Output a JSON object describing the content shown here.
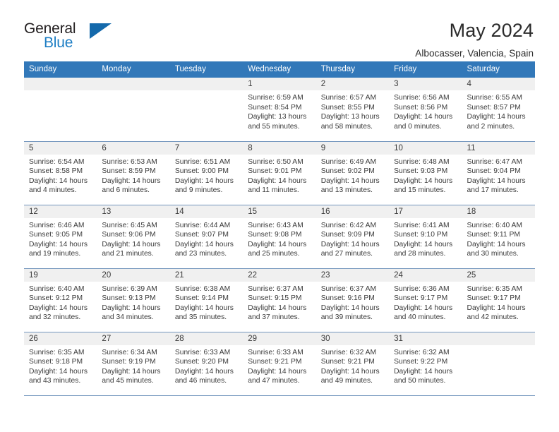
{
  "brand": {
    "name_part1": "General",
    "name_part2": "Blue",
    "logo_icon": "triangle-icon",
    "color_dark": "#231f20",
    "color_blue": "#1d7ec4",
    "color_triangle": "#1469ab"
  },
  "header": {
    "title": "May 2024",
    "subtitle": "Albocasser, Valencia, Spain"
  },
  "theme": {
    "header_row_bg": "#3278b9",
    "daynum_bg": "#f0f0f0",
    "row_border": "#7396bd"
  },
  "weekdays": [
    "Sunday",
    "Monday",
    "Tuesday",
    "Wednesday",
    "Thursday",
    "Friday",
    "Saturday"
  ],
  "weeks": [
    [
      {
        "day": "",
        "empty": true
      },
      {
        "day": "",
        "empty": true
      },
      {
        "day": "",
        "empty": true
      },
      {
        "day": "1",
        "sunrise": "Sunrise: 6:59 AM",
        "sunset": "Sunset: 8:54 PM",
        "daylight1": "Daylight: 13 hours",
        "daylight2": "and 55 minutes."
      },
      {
        "day": "2",
        "sunrise": "Sunrise: 6:57 AM",
        "sunset": "Sunset: 8:55 PM",
        "daylight1": "Daylight: 13 hours",
        "daylight2": "and 58 minutes."
      },
      {
        "day": "3",
        "sunrise": "Sunrise: 6:56 AM",
        "sunset": "Sunset: 8:56 PM",
        "daylight1": "Daylight: 14 hours",
        "daylight2": "and 0 minutes."
      },
      {
        "day": "4",
        "sunrise": "Sunrise: 6:55 AM",
        "sunset": "Sunset: 8:57 PM",
        "daylight1": "Daylight: 14 hours",
        "daylight2": "and 2 minutes."
      }
    ],
    [
      {
        "day": "5",
        "sunrise": "Sunrise: 6:54 AM",
        "sunset": "Sunset: 8:58 PM",
        "daylight1": "Daylight: 14 hours",
        "daylight2": "and 4 minutes."
      },
      {
        "day": "6",
        "sunrise": "Sunrise: 6:53 AM",
        "sunset": "Sunset: 8:59 PM",
        "daylight1": "Daylight: 14 hours",
        "daylight2": "and 6 minutes."
      },
      {
        "day": "7",
        "sunrise": "Sunrise: 6:51 AM",
        "sunset": "Sunset: 9:00 PM",
        "daylight1": "Daylight: 14 hours",
        "daylight2": "and 9 minutes."
      },
      {
        "day": "8",
        "sunrise": "Sunrise: 6:50 AM",
        "sunset": "Sunset: 9:01 PM",
        "daylight1": "Daylight: 14 hours",
        "daylight2": "and 11 minutes."
      },
      {
        "day": "9",
        "sunrise": "Sunrise: 6:49 AM",
        "sunset": "Sunset: 9:02 PM",
        "daylight1": "Daylight: 14 hours",
        "daylight2": "and 13 minutes."
      },
      {
        "day": "10",
        "sunrise": "Sunrise: 6:48 AM",
        "sunset": "Sunset: 9:03 PM",
        "daylight1": "Daylight: 14 hours",
        "daylight2": "and 15 minutes."
      },
      {
        "day": "11",
        "sunrise": "Sunrise: 6:47 AM",
        "sunset": "Sunset: 9:04 PM",
        "daylight1": "Daylight: 14 hours",
        "daylight2": "and 17 minutes."
      }
    ],
    [
      {
        "day": "12",
        "sunrise": "Sunrise: 6:46 AM",
        "sunset": "Sunset: 9:05 PM",
        "daylight1": "Daylight: 14 hours",
        "daylight2": "and 19 minutes."
      },
      {
        "day": "13",
        "sunrise": "Sunrise: 6:45 AM",
        "sunset": "Sunset: 9:06 PM",
        "daylight1": "Daylight: 14 hours",
        "daylight2": "and 21 minutes."
      },
      {
        "day": "14",
        "sunrise": "Sunrise: 6:44 AM",
        "sunset": "Sunset: 9:07 PM",
        "daylight1": "Daylight: 14 hours",
        "daylight2": "and 23 minutes."
      },
      {
        "day": "15",
        "sunrise": "Sunrise: 6:43 AM",
        "sunset": "Sunset: 9:08 PM",
        "daylight1": "Daylight: 14 hours",
        "daylight2": "and 25 minutes."
      },
      {
        "day": "16",
        "sunrise": "Sunrise: 6:42 AM",
        "sunset": "Sunset: 9:09 PM",
        "daylight1": "Daylight: 14 hours",
        "daylight2": "and 27 minutes."
      },
      {
        "day": "17",
        "sunrise": "Sunrise: 6:41 AM",
        "sunset": "Sunset: 9:10 PM",
        "daylight1": "Daylight: 14 hours",
        "daylight2": "and 28 minutes."
      },
      {
        "day": "18",
        "sunrise": "Sunrise: 6:40 AM",
        "sunset": "Sunset: 9:11 PM",
        "daylight1": "Daylight: 14 hours",
        "daylight2": "and 30 minutes."
      }
    ],
    [
      {
        "day": "19",
        "sunrise": "Sunrise: 6:40 AM",
        "sunset": "Sunset: 9:12 PM",
        "daylight1": "Daylight: 14 hours",
        "daylight2": "and 32 minutes."
      },
      {
        "day": "20",
        "sunrise": "Sunrise: 6:39 AM",
        "sunset": "Sunset: 9:13 PM",
        "daylight1": "Daylight: 14 hours",
        "daylight2": "and 34 minutes."
      },
      {
        "day": "21",
        "sunrise": "Sunrise: 6:38 AM",
        "sunset": "Sunset: 9:14 PM",
        "daylight1": "Daylight: 14 hours",
        "daylight2": "and 35 minutes."
      },
      {
        "day": "22",
        "sunrise": "Sunrise: 6:37 AM",
        "sunset": "Sunset: 9:15 PM",
        "daylight1": "Daylight: 14 hours",
        "daylight2": "and 37 minutes."
      },
      {
        "day": "23",
        "sunrise": "Sunrise: 6:37 AM",
        "sunset": "Sunset: 9:16 PM",
        "daylight1": "Daylight: 14 hours",
        "daylight2": "and 39 minutes."
      },
      {
        "day": "24",
        "sunrise": "Sunrise: 6:36 AM",
        "sunset": "Sunset: 9:17 PM",
        "daylight1": "Daylight: 14 hours",
        "daylight2": "and 40 minutes."
      },
      {
        "day": "25",
        "sunrise": "Sunrise: 6:35 AM",
        "sunset": "Sunset: 9:17 PM",
        "daylight1": "Daylight: 14 hours",
        "daylight2": "and 42 minutes."
      }
    ],
    [
      {
        "day": "26",
        "sunrise": "Sunrise: 6:35 AM",
        "sunset": "Sunset: 9:18 PM",
        "daylight1": "Daylight: 14 hours",
        "daylight2": "and 43 minutes."
      },
      {
        "day": "27",
        "sunrise": "Sunrise: 6:34 AM",
        "sunset": "Sunset: 9:19 PM",
        "daylight1": "Daylight: 14 hours",
        "daylight2": "and 45 minutes."
      },
      {
        "day": "28",
        "sunrise": "Sunrise: 6:33 AM",
        "sunset": "Sunset: 9:20 PM",
        "daylight1": "Daylight: 14 hours",
        "daylight2": "and 46 minutes."
      },
      {
        "day": "29",
        "sunrise": "Sunrise: 6:33 AM",
        "sunset": "Sunset: 9:21 PM",
        "daylight1": "Daylight: 14 hours",
        "daylight2": "and 47 minutes."
      },
      {
        "day": "30",
        "sunrise": "Sunrise: 6:32 AM",
        "sunset": "Sunset: 9:21 PM",
        "daylight1": "Daylight: 14 hours",
        "daylight2": "and 49 minutes."
      },
      {
        "day": "31",
        "sunrise": "Sunrise: 6:32 AM",
        "sunset": "Sunset: 9:22 PM",
        "daylight1": "Daylight: 14 hours",
        "daylight2": "and 50 minutes."
      },
      {
        "day": "",
        "empty": true
      }
    ]
  ]
}
